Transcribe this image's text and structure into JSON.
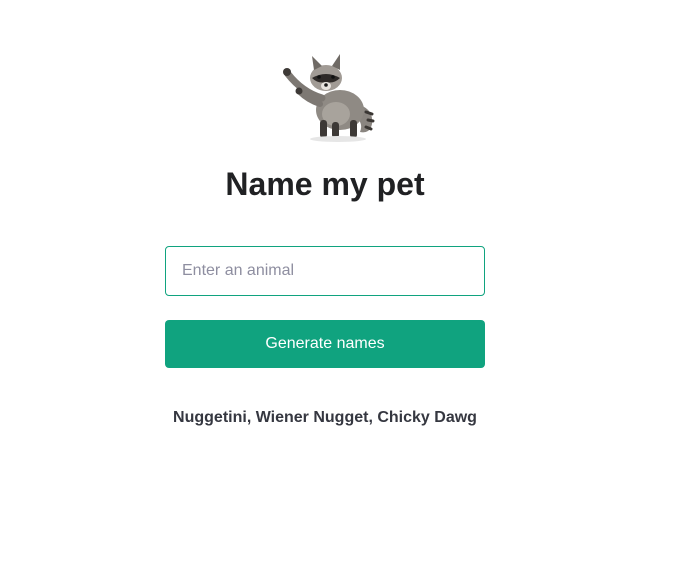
{
  "logo": {
    "icon": "raccoon-icon"
  },
  "main": {
    "title": "Name my pet",
    "animal_input": {
      "value": "",
      "placeholder": "Enter an animal"
    },
    "generate_label": "Generate names",
    "result": "Nuggetini, Wiener Nugget, Chicky Dawg"
  },
  "colors": {
    "accent": "#10a37f",
    "title": "#202123",
    "text": "#353740",
    "placeholder": "#8e8ea0"
  }
}
